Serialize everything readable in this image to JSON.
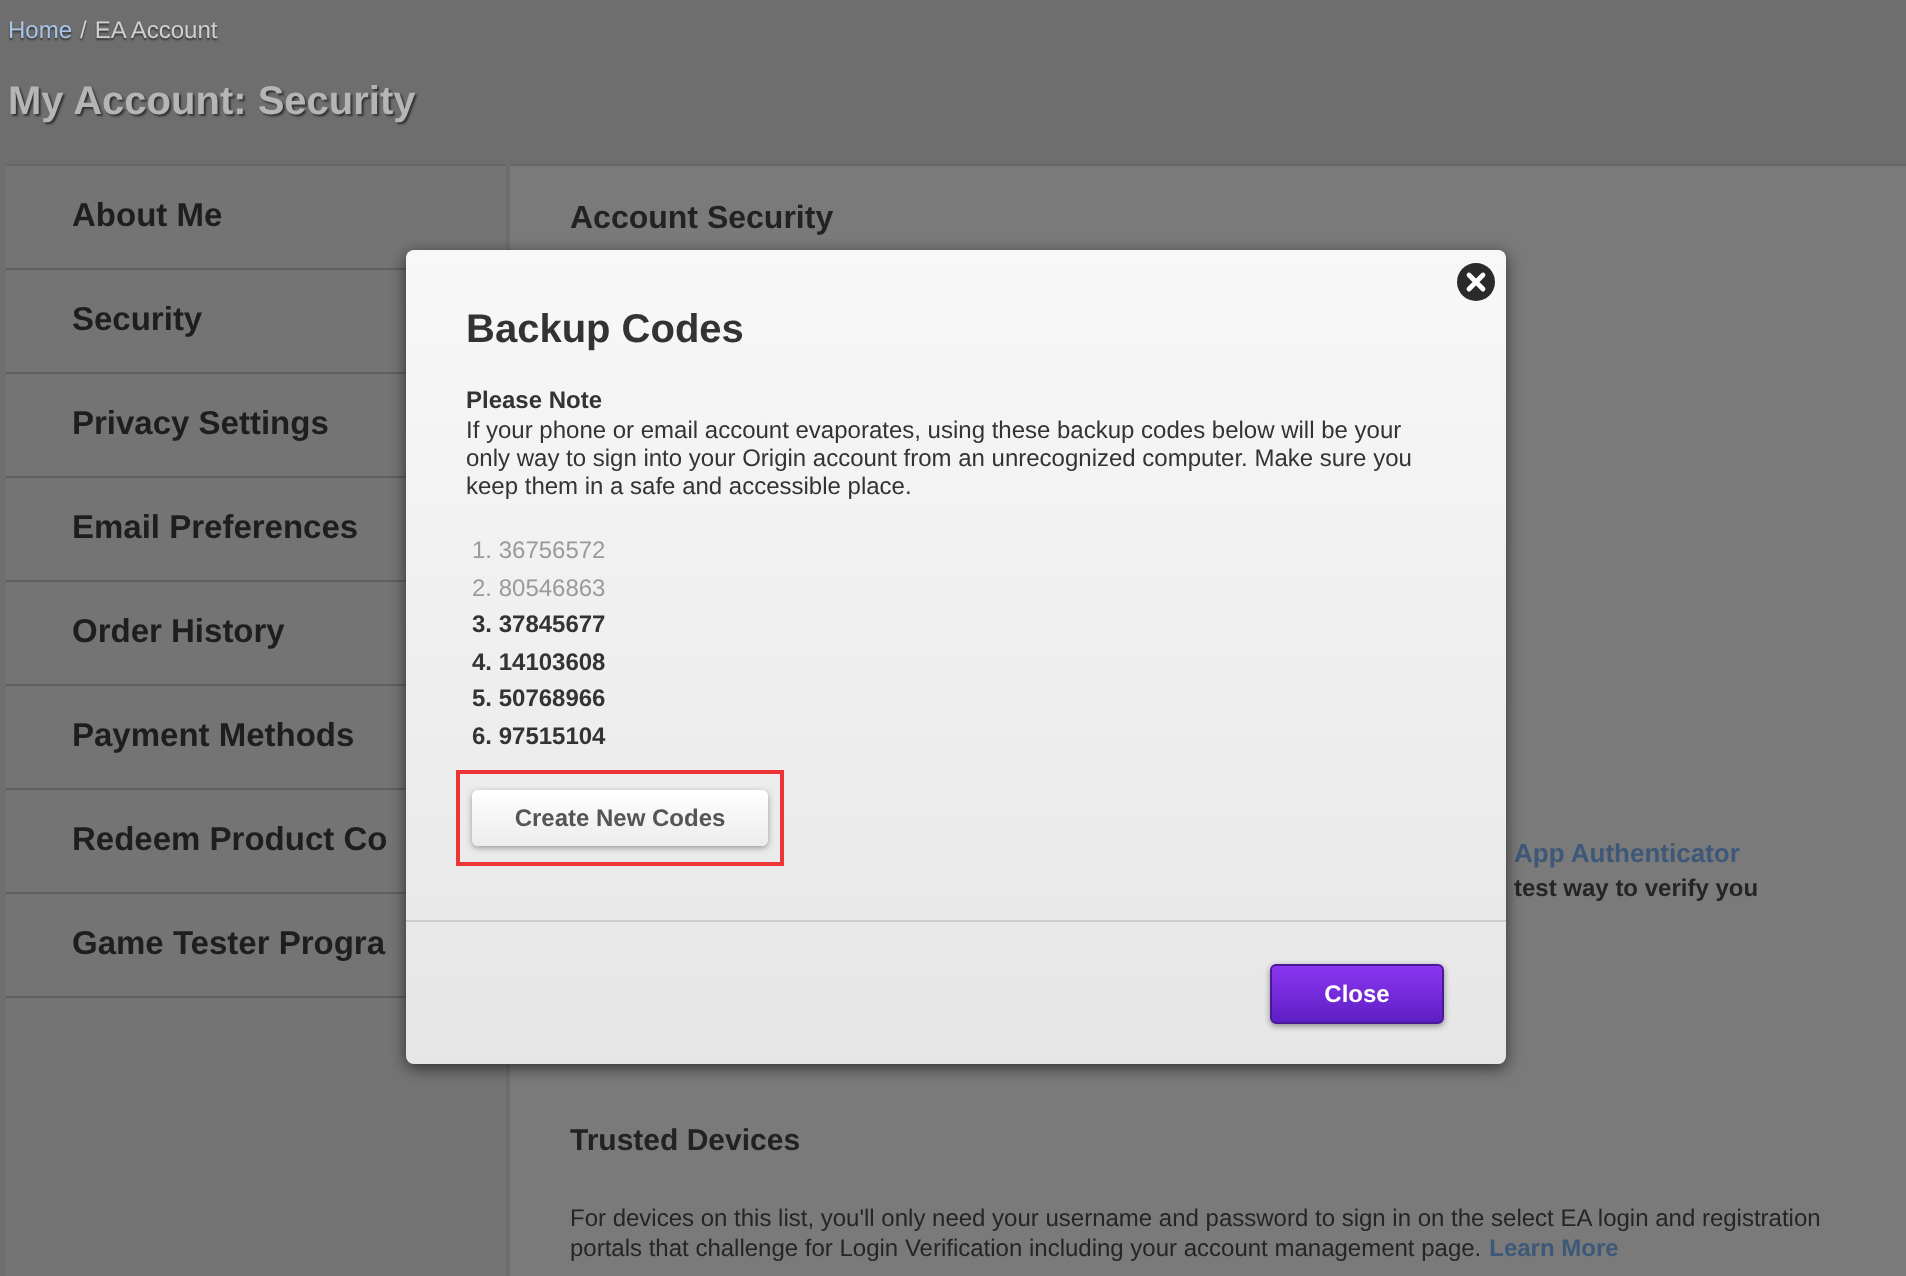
{
  "breadcrumb": {
    "home": "Home",
    "separator": "/",
    "current": "EA Account"
  },
  "page_title": "My Account: Security",
  "sidebar": {
    "items": [
      "About Me",
      "Security",
      "Privacy Settings",
      "Email Preferences",
      "Order History",
      "Payment Methods",
      "Redeem Product Co",
      "Game Tester Progra"
    ]
  },
  "content": {
    "section_title": "Account Security",
    "authenticator": {
      "title": "App Authenticator",
      "text": "test way to verify you"
    },
    "trusted_devices": {
      "title": "Trusted Devices",
      "text": "For devices on this list, you'll only need your username and password to sign in on the select EA login and registration portals that challenge for Login Verification including your account management page.",
      "link": "Learn More"
    }
  },
  "dialog": {
    "title": "Backup Codes",
    "note_title": "Please Note",
    "note": "If your phone or email account evaporates, using these backup codes below will be your only way to sign into your Origin account from an unrecognized computer. Make sure you keep them in a safe and accessible place.",
    "codes": [
      {
        "label": "1. 36756572",
        "used": true
      },
      {
        "label": "2. 80546863",
        "used": true
      },
      {
        "label": "3. 37845677",
        "used": false
      },
      {
        "label": "4. 14103608",
        "used": false
      },
      {
        "label": "5. 50768966",
        "used": false
      },
      {
        "label": "6. 97515104",
        "used": false
      }
    ],
    "create_button": {
      "label": "Create New Codes",
      "highlighted": true
    },
    "close_button": "Close"
  }
}
